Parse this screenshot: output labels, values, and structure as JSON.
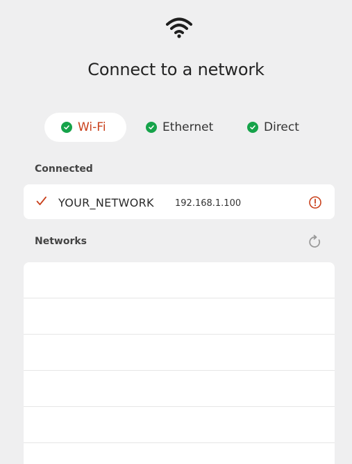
{
  "header": {
    "icon": "wifi-icon",
    "title": "Connect to a network"
  },
  "tabs": [
    {
      "label": "Wi-Fi",
      "status": "connected",
      "active": true
    },
    {
      "label": "Ethernet",
      "status": "connected",
      "active": false
    },
    {
      "label": "Direct",
      "status": "connected",
      "active": false
    }
  ],
  "connected": {
    "section_label": "Connected",
    "network_name": "YOUR_NETWORK",
    "ip_address": "192.168.1.100",
    "icons": [
      "checkmark-icon",
      "info-icon"
    ]
  },
  "networks": {
    "section_label": "Networks",
    "refresh_icon": "refresh-icon",
    "items": [
      "",
      "",
      "",
      "",
      "",
      ""
    ]
  },
  "colors": {
    "background": "#efeff0",
    "accent": "#c9401b",
    "success": "#16a34a",
    "card": "#ffffff"
  }
}
